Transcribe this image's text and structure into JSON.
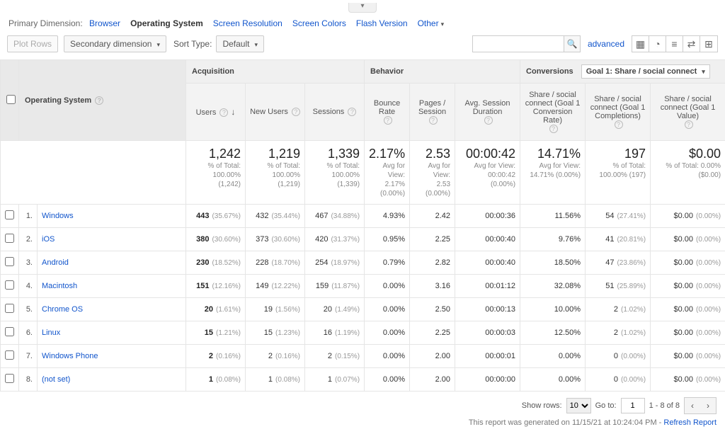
{
  "primary_dimension": {
    "label": "Primary Dimension:",
    "items": [
      "Browser",
      "Operating System",
      "Screen Resolution",
      "Screen Colors",
      "Flash Version",
      "Other"
    ],
    "active": "Operating System"
  },
  "toolbar": {
    "plot_rows": "Plot Rows",
    "secondary_dim": "Secondary dimension",
    "sort_type_label": "Sort Type:",
    "sort_type_value": "Default",
    "advanced": "advanced"
  },
  "conversions": {
    "label": "Conversions",
    "selected": "Goal 1: Share / social connect"
  },
  "dimension_header": "Operating System",
  "groups": {
    "acq": "Acquisition",
    "beh": "Behavior",
    "conv": "Conversions"
  },
  "cols": {
    "users": "Users",
    "new_users": "New Users",
    "sessions": "Sessions",
    "bounce": "Bounce Rate",
    "pps": "Pages / Session",
    "duration": "Avg. Session Duration",
    "g1rate": "Share / social connect (Goal 1 Conversion Rate)",
    "g1comp": "Share / social connect (Goal 1 Completions)",
    "g1val": "Share / social connect (Goal 1 Value)"
  },
  "summary": {
    "users": {
      "v": "1,242",
      "s1": "% of Total:",
      "s2": "100.00%",
      "s3": "(1,242)"
    },
    "newu": {
      "v": "1,219",
      "s1": "% of Total:",
      "s2": "100.00%",
      "s3": "(1,219)"
    },
    "sess": {
      "v": "1,339",
      "s1": "% of Total:",
      "s2": "100.00%",
      "s3": "(1,339)"
    },
    "bounce": {
      "v": "2.17%",
      "s1": "Avg for",
      "s2": "View: 2.17%",
      "s3": "(0.00%)"
    },
    "pps": {
      "v": "2.53",
      "s1": "Avg for",
      "s2": "View:",
      "s3": "2.53",
      "s4": "(0.00%)"
    },
    "dur": {
      "v": "00:00:42",
      "s1": "Avg for View:",
      "s2": "00:00:42",
      "s3": "(0.00%)"
    },
    "g1r": {
      "v": "14.71%",
      "s1": "Avg for View:",
      "s2": "14.71% (0.00%)"
    },
    "g1c": {
      "v": "197",
      "s1": "% of Total:",
      "s2": "100.00% (197)"
    },
    "g1v": {
      "v": "$0.00",
      "s1": "% of Total: 0.00%",
      "s2": "($0.00)"
    }
  },
  "rows": [
    {
      "n": "1.",
      "os": "Windows",
      "u": "443",
      "up": "(35.67%)",
      "nu": "432",
      "nup": "(35.44%)",
      "s": "467",
      "sp": "(34.88%)",
      "b": "4.93%",
      "p": "2.42",
      "d": "00:00:36",
      "r": "11.56%",
      "c": "54",
      "cp": "(27.41%)",
      "v": "$0.00",
      "vp": "(0.00%)"
    },
    {
      "n": "2.",
      "os": "iOS",
      "u": "380",
      "up": "(30.60%)",
      "nu": "373",
      "nup": "(30.60%)",
      "s": "420",
      "sp": "(31.37%)",
      "b": "0.95%",
      "p": "2.25",
      "d": "00:00:40",
      "r": "9.76%",
      "c": "41",
      "cp": "(20.81%)",
      "v": "$0.00",
      "vp": "(0.00%)"
    },
    {
      "n": "3.",
      "os": "Android",
      "u": "230",
      "up": "(18.52%)",
      "nu": "228",
      "nup": "(18.70%)",
      "s": "254",
      "sp": "(18.97%)",
      "b": "0.79%",
      "p": "2.82",
      "d": "00:00:40",
      "r": "18.50%",
      "c": "47",
      "cp": "(23.86%)",
      "v": "$0.00",
      "vp": "(0.00%)"
    },
    {
      "n": "4.",
      "os": "Macintosh",
      "u": "151",
      "up": "(12.16%)",
      "nu": "149",
      "nup": "(12.22%)",
      "s": "159",
      "sp": "(11.87%)",
      "b": "0.00%",
      "p": "3.16",
      "d": "00:01:12",
      "r": "32.08%",
      "c": "51",
      "cp": "(25.89%)",
      "v": "$0.00",
      "vp": "(0.00%)"
    },
    {
      "n": "5.",
      "os": "Chrome OS",
      "u": "20",
      "up": "(1.61%)",
      "nu": "19",
      "nup": "(1.56%)",
      "s": "20",
      "sp": "(1.49%)",
      "b": "0.00%",
      "p": "2.50",
      "d": "00:00:13",
      "r": "10.00%",
      "c": "2",
      "cp": "(1.02%)",
      "v": "$0.00",
      "vp": "(0.00%)"
    },
    {
      "n": "6.",
      "os": "Linux",
      "u": "15",
      "up": "(1.21%)",
      "nu": "15",
      "nup": "(1.23%)",
      "s": "16",
      "sp": "(1.19%)",
      "b": "0.00%",
      "p": "2.25",
      "d": "00:00:03",
      "r": "12.50%",
      "c": "2",
      "cp": "(1.02%)",
      "v": "$0.00",
      "vp": "(0.00%)"
    },
    {
      "n": "7.",
      "os": "Windows Phone",
      "u": "2",
      "up": "(0.16%)",
      "nu": "2",
      "nup": "(0.16%)",
      "s": "2",
      "sp": "(0.15%)",
      "b": "0.00%",
      "p": "2.00",
      "d": "00:00:01",
      "r": "0.00%",
      "c": "0",
      "cp": "(0.00%)",
      "v": "$0.00",
      "vp": "(0.00%)"
    },
    {
      "n": "8.",
      "os": "(not set)",
      "u": "1",
      "up": "(0.08%)",
      "nu": "1",
      "nup": "(0.08%)",
      "s": "1",
      "sp": "(0.07%)",
      "b": "0.00%",
      "p": "2.00",
      "d": "00:00:00",
      "r": "0.00%",
      "c": "0",
      "cp": "(0.00%)",
      "v": "$0.00",
      "vp": "(0.00%)"
    }
  ],
  "footer": {
    "show_rows": "Show rows:",
    "show_rows_val": "10",
    "goto": "Go to:",
    "goto_val": "1",
    "range": "1 - 8 of 8",
    "gen": "This report was generated on 11/15/21 at 10:24:04 PM - ",
    "refresh": "Refresh Report"
  }
}
